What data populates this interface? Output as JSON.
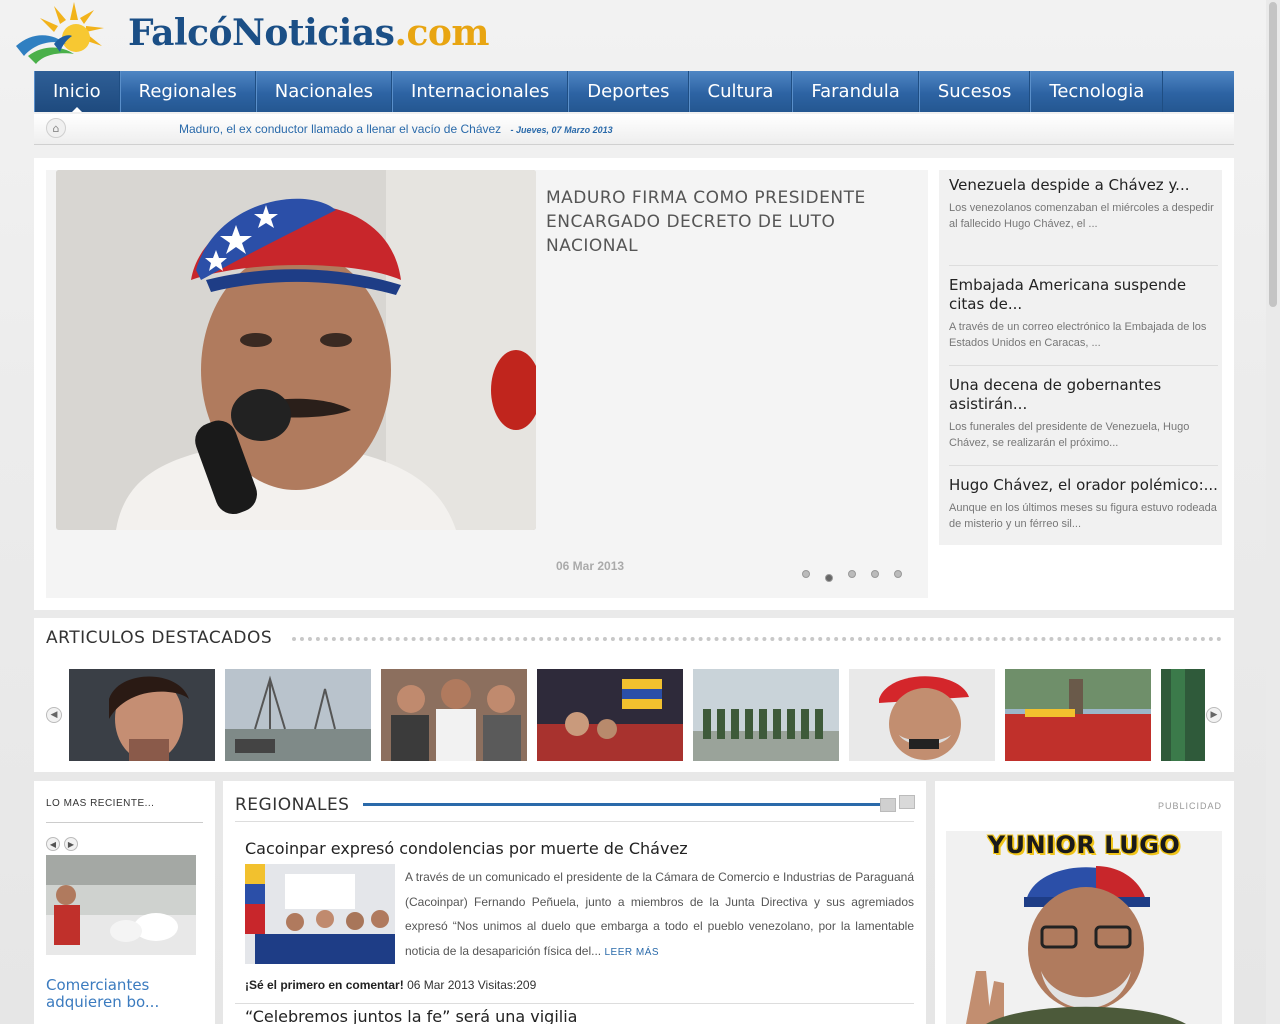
{
  "site": {
    "logo_text": "FalcóNoticias",
    "logo_tld": ".com"
  },
  "nav": {
    "items": [
      {
        "label": "Inicio"
      },
      {
        "label": "Regionales"
      },
      {
        "label": "Nacionales"
      },
      {
        "label": "Internacionales"
      },
      {
        "label": "Deportes"
      },
      {
        "label": "Cultura"
      },
      {
        "label": "Farandula"
      },
      {
        "label": "Sucesos"
      },
      {
        "label": "Tecnologia"
      }
    ],
    "active": "Inicio"
  },
  "ticker": {
    "headline": "Maduro, el ex conductor llamado a llenar el vacío de Chávez",
    "date": "-  Jueves, 07 Marzo 2013"
  },
  "featured": {
    "title": "MADURO FIRMA COMO PRESIDENTE ENCARGADO DECRETO DE LUTO NACIONAL",
    "date": "06 Mar 2013",
    "slide_count": 5,
    "active_slide": 2,
    "side_items": [
      {
        "title": "Venezuela despide a Chávez y...",
        "desc": "Los venezolanos comenzaban el miércoles a despedir al fallecido Hugo Chávez, el ..."
      },
      {
        "title": "Embajada Americana suspende citas de...",
        "desc": "A través de un correo electrónico la Embajada de los Estados Unidos en Caracas, ..."
      },
      {
        "title": "Una decena de gobernantes asistirán...",
        "desc": "Los funerales del presidente de Venezuela, Hugo Chávez, se realizarán el próximo..."
      },
      {
        "title": "Hugo Chávez, el orador polémico:...",
        "desc": "Aunque en los últimos meses su figura estuvo rodeada de misterio y un férreo sil..."
      }
    ]
  },
  "destacados": {
    "title": "ARTICULOS DESTACADOS"
  },
  "recent": {
    "title": "LO MAS RECIENTE...",
    "headline": "Comerciantes adquieren bo..."
  },
  "regionales": {
    "title": "REGIONALES",
    "article": {
      "headline": "Cacoinpar expresó condolencias por muerte de Chávez",
      "body": "A través de un comunicado el presidente de la Cámara de Comercio e Industrias de Paraguaná (Cacoinpar) Fernando Peñuela, junto a miembros de la Junta Directiva y sus agremiados expresó “Nos unimos al duelo que embarga a todo el pueblo venezolano, por la lamentable noticia de la desaparición física del...",
      "more": "LEER MÁS",
      "comment": "¡Sé el primero en comentar!",
      "meta": "06 Mar 2013 Visitas:209"
    },
    "next_headline": "“Celebremos juntos la fe” será una vigilia"
  },
  "publicidad": {
    "label": "PUBLICIDAD",
    "ad_name": "YUNIOR LUGO"
  },
  "colors": {
    "nav_blue": "#2d63a3",
    "link_blue": "#2a6aaa",
    "logo_blue": "#1b4f86",
    "logo_orange": "#e8a512"
  }
}
